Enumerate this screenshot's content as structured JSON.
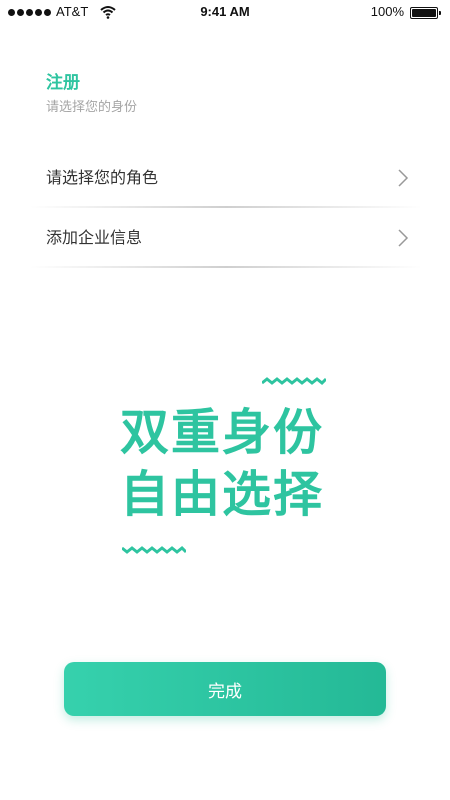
{
  "status_bar": {
    "carrier": "AT&T",
    "time": "9:41 AM",
    "battery": "100%"
  },
  "header": {
    "title": "注册",
    "subtitle": "请选择您的身份"
  },
  "list": {
    "items": [
      {
        "label": "请选择您的角色",
        "icon": "chevron-right-icon"
      },
      {
        "label": "添加企业信息",
        "icon": "chevron-right-icon"
      }
    ]
  },
  "slogan": {
    "line1": "双重身份",
    "line2": "自由选择"
  },
  "actions": {
    "done_label": "完成"
  },
  "colors": {
    "accent": "#2ec4a0",
    "button_start": "#36d1ad",
    "button_end": "#24b996",
    "subtitle": "#a5a5a5"
  }
}
